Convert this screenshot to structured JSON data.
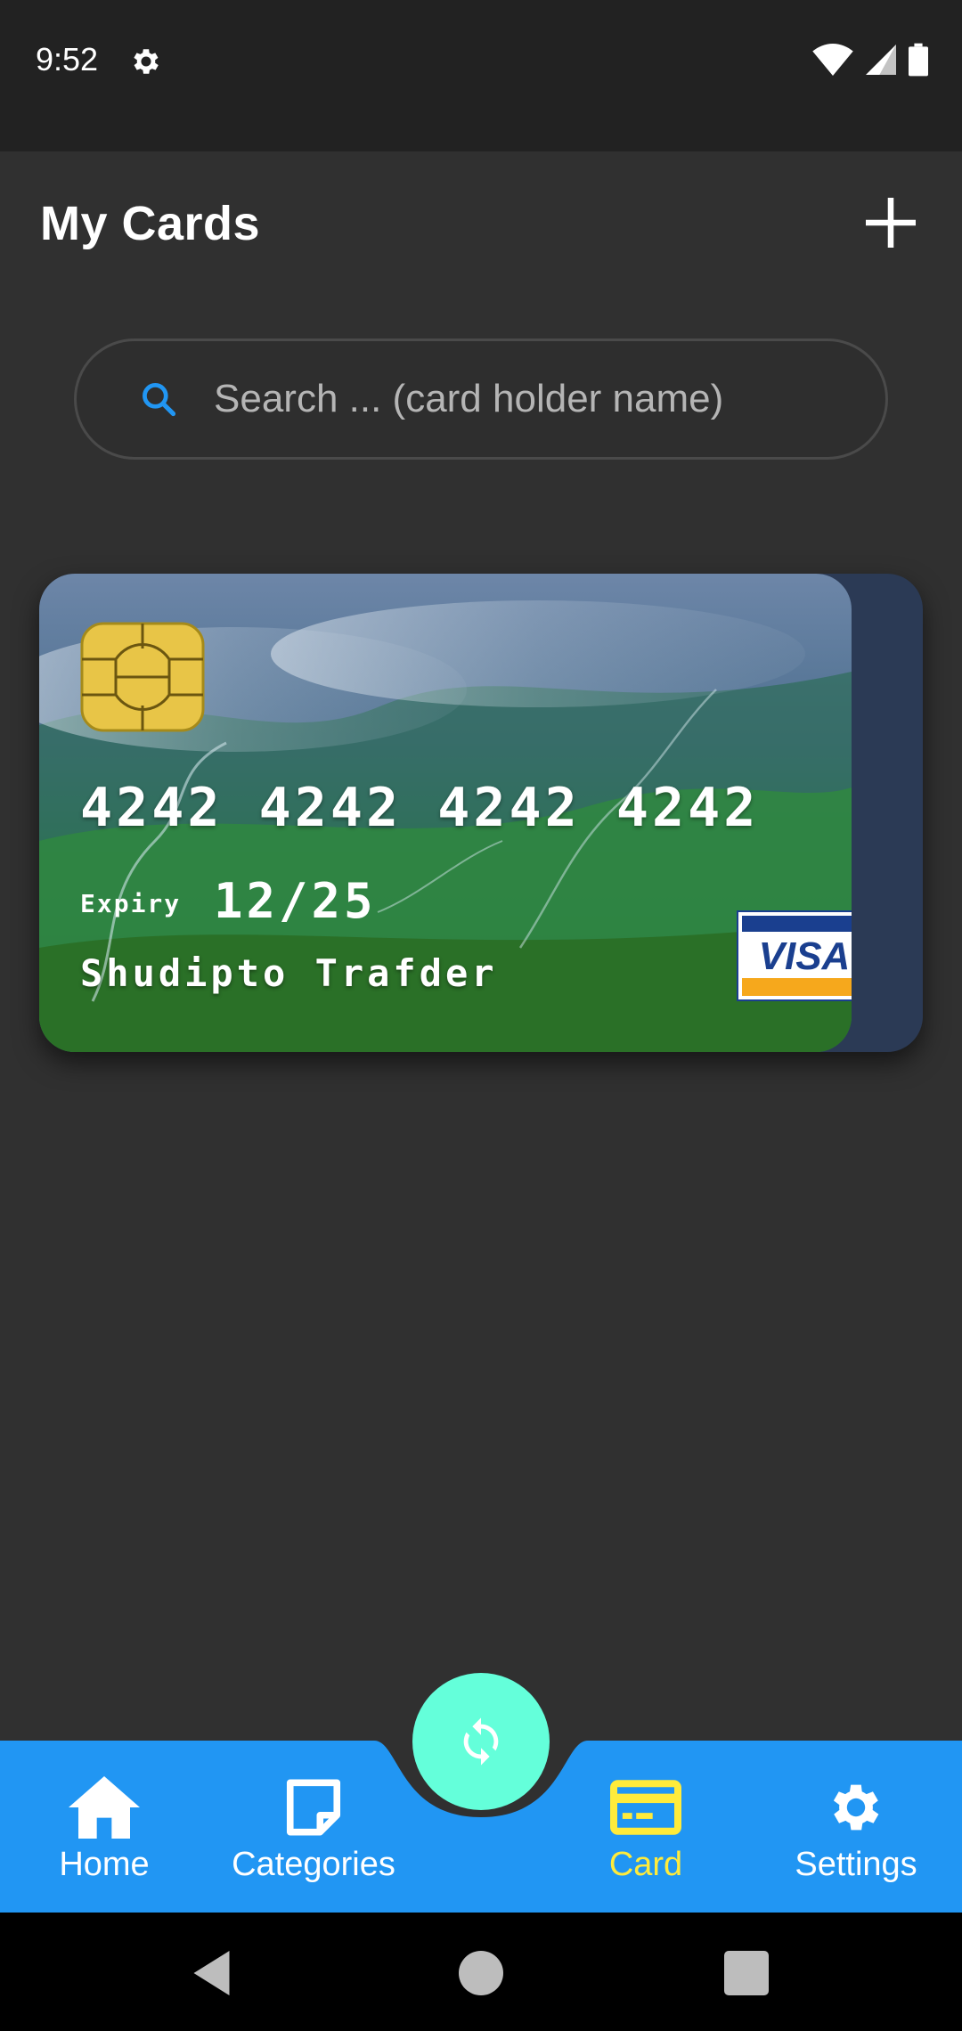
{
  "status_bar": {
    "time": "9:52",
    "icons": [
      "settings-icon",
      "wifi-icon",
      "signal-icon",
      "battery-icon"
    ]
  },
  "app_bar": {
    "title": "My Cards",
    "add_icon": "plus-icon"
  },
  "search": {
    "placeholder": "Search ... (card holder name)",
    "value": ""
  },
  "card": {
    "number": "4242 4242 4242 4242",
    "expiry_label": "Expiry",
    "expiry": "12/25",
    "holder": "Shudipto Trafder",
    "brand": "VISA",
    "back_color": "#2b3a55"
  },
  "fab": {
    "icon": "sync-icon",
    "color": "#64ffda"
  },
  "bottom_nav": {
    "color": "#2196f3",
    "active_color": "#ffeb3b",
    "items": [
      {
        "label": "Home",
        "icon": "home-icon"
      },
      {
        "label": "Categories",
        "icon": "note-icon"
      },
      {
        "label": "Card",
        "icon": "credit-card-icon",
        "active": true
      },
      {
        "label": "Settings",
        "icon": "settings-icon"
      }
    ]
  }
}
